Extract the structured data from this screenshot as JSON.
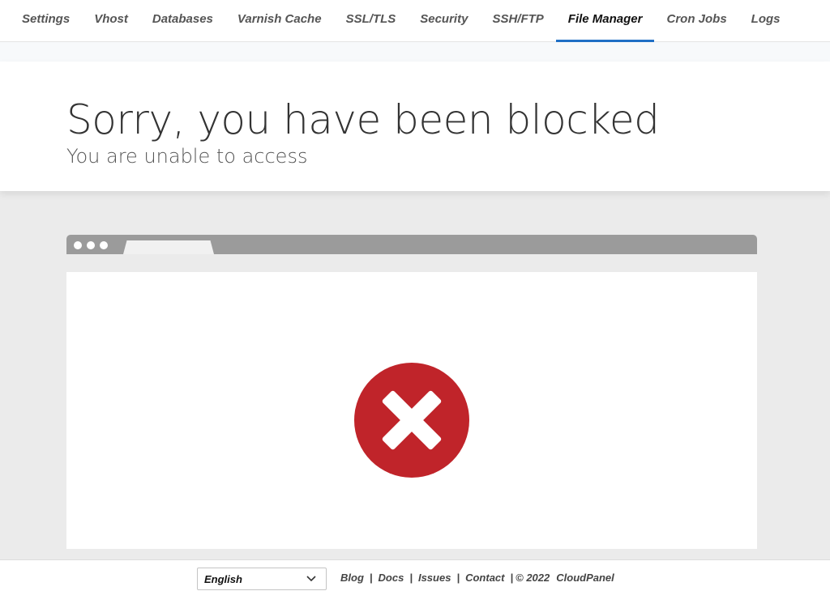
{
  "nav": {
    "tabs": [
      {
        "label": "Settings"
      },
      {
        "label": "Vhost"
      },
      {
        "label": "Databases"
      },
      {
        "label": "Varnish Cache"
      },
      {
        "label": "SSL/TLS"
      },
      {
        "label": "Security"
      },
      {
        "label": "SSH/FTP"
      },
      {
        "label": "File Manager",
        "active": true
      },
      {
        "label": "Cron Jobs"
      },
      {
        "label": "Logs"
      }
    ],
    "accent_color": "#1f6fc5"
  },
  "header": {
    "title": "Sorry, you have been blocked",
    "subtitle": "You are unable to access"
  },
  "blocked_illustration": {
    "icon": "x-circle-icon",
    "color": "#c0242a"
  },
  "footer": {
    "language": {
      "selected": "English",
      "icon": "chevron-down-icon"
    },
    "links": [
      {
        "label": "Blog"
      },
      {
        "label": "Docs"
      },
      {
        "label": "Issues"
      },
      {
        "label": "Contact"
      }
    ],
    "separator": "|",
    "copyright": "© 2022",
    "brand": "CloudPanel"
  }
}
